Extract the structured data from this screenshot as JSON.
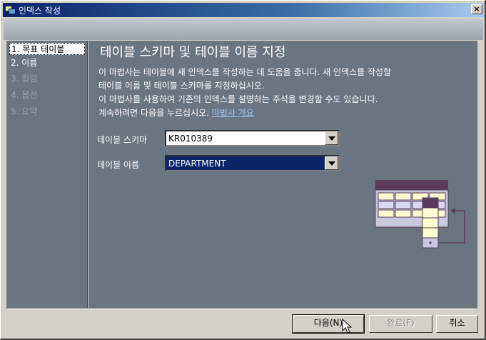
{
  "window": {
    "title": "인덱스 작성",
    "close_label": "×"
  },
  "sidebar": {
    "items": [
      {
        "label": "1. 목표 테이블",
        "state": "selected"
      },
      {
        "label": "2. 이름",
        "state": "enabled"
      },
      {
        "label": "3. 컬럼",
        "state": "disabled"
      },
      {
        "label": "4. 옵션",
        "state": "disabled"
      },
      {
        "label": "5. 요약",
        "state": "disabled"
      }
    ]
  },
  "main": {
    "title": "테이블 스키마 및 테이블 이름 지정",
    "description": [
      "이 마법사는 테이블에 새 인덱스를 작성하는 데 도움을 줍니다. 새 인덱스를 작성할",
      "테이블 이름 및 테이블 스키마를 지정하십시오.",
      "이 마법사를 사용하여 기존의 인덱스를 설명하는 주석을 변경할 수도 있습니다.",
      "계속하려면 다음을 누르십시오."
    ],
    "wizard_link": "마법사 개요",
    "fields": {
      "schema": {
        "label": "테이블 스키마",
        "value": "KR010389"
      },
      "table": {
        "label": "테이블 이름",
        "value": "DEPARTMENT"
      }
    }
  },
  "buttons": {
    "next": "다음(N)",
    "finish": "완료(F)",
    "cancel": "취소"
  },
  "colors": {
    "panel": "#6a7582",
    "title_bar": "#0a246a",
    "table_header": "#5a3a58",
    "table_row": "#ffffd0"
  }
}
